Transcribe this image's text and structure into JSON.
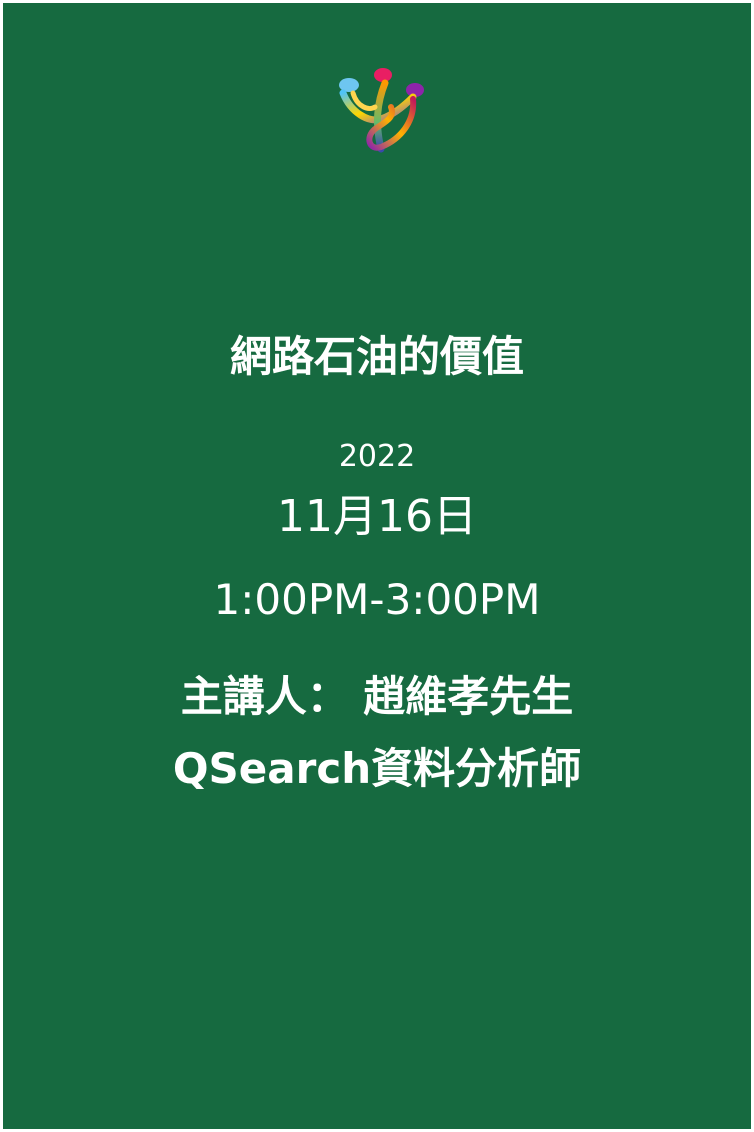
{
  "poster": {
    "background_color": "#166a40",
    "text_color": "#ffffff",
    "logo_icon": "colorful-people-logo-icon",
    "title": "網路石油的價值",
    "year": "2022",
    "date": "11月16日",
    "time": "1:00PM-3:00PM",
    "speaker": "主講人： 趙維孝先生",
    "speaker_role": "QSearch資料分析師"
  }
}
